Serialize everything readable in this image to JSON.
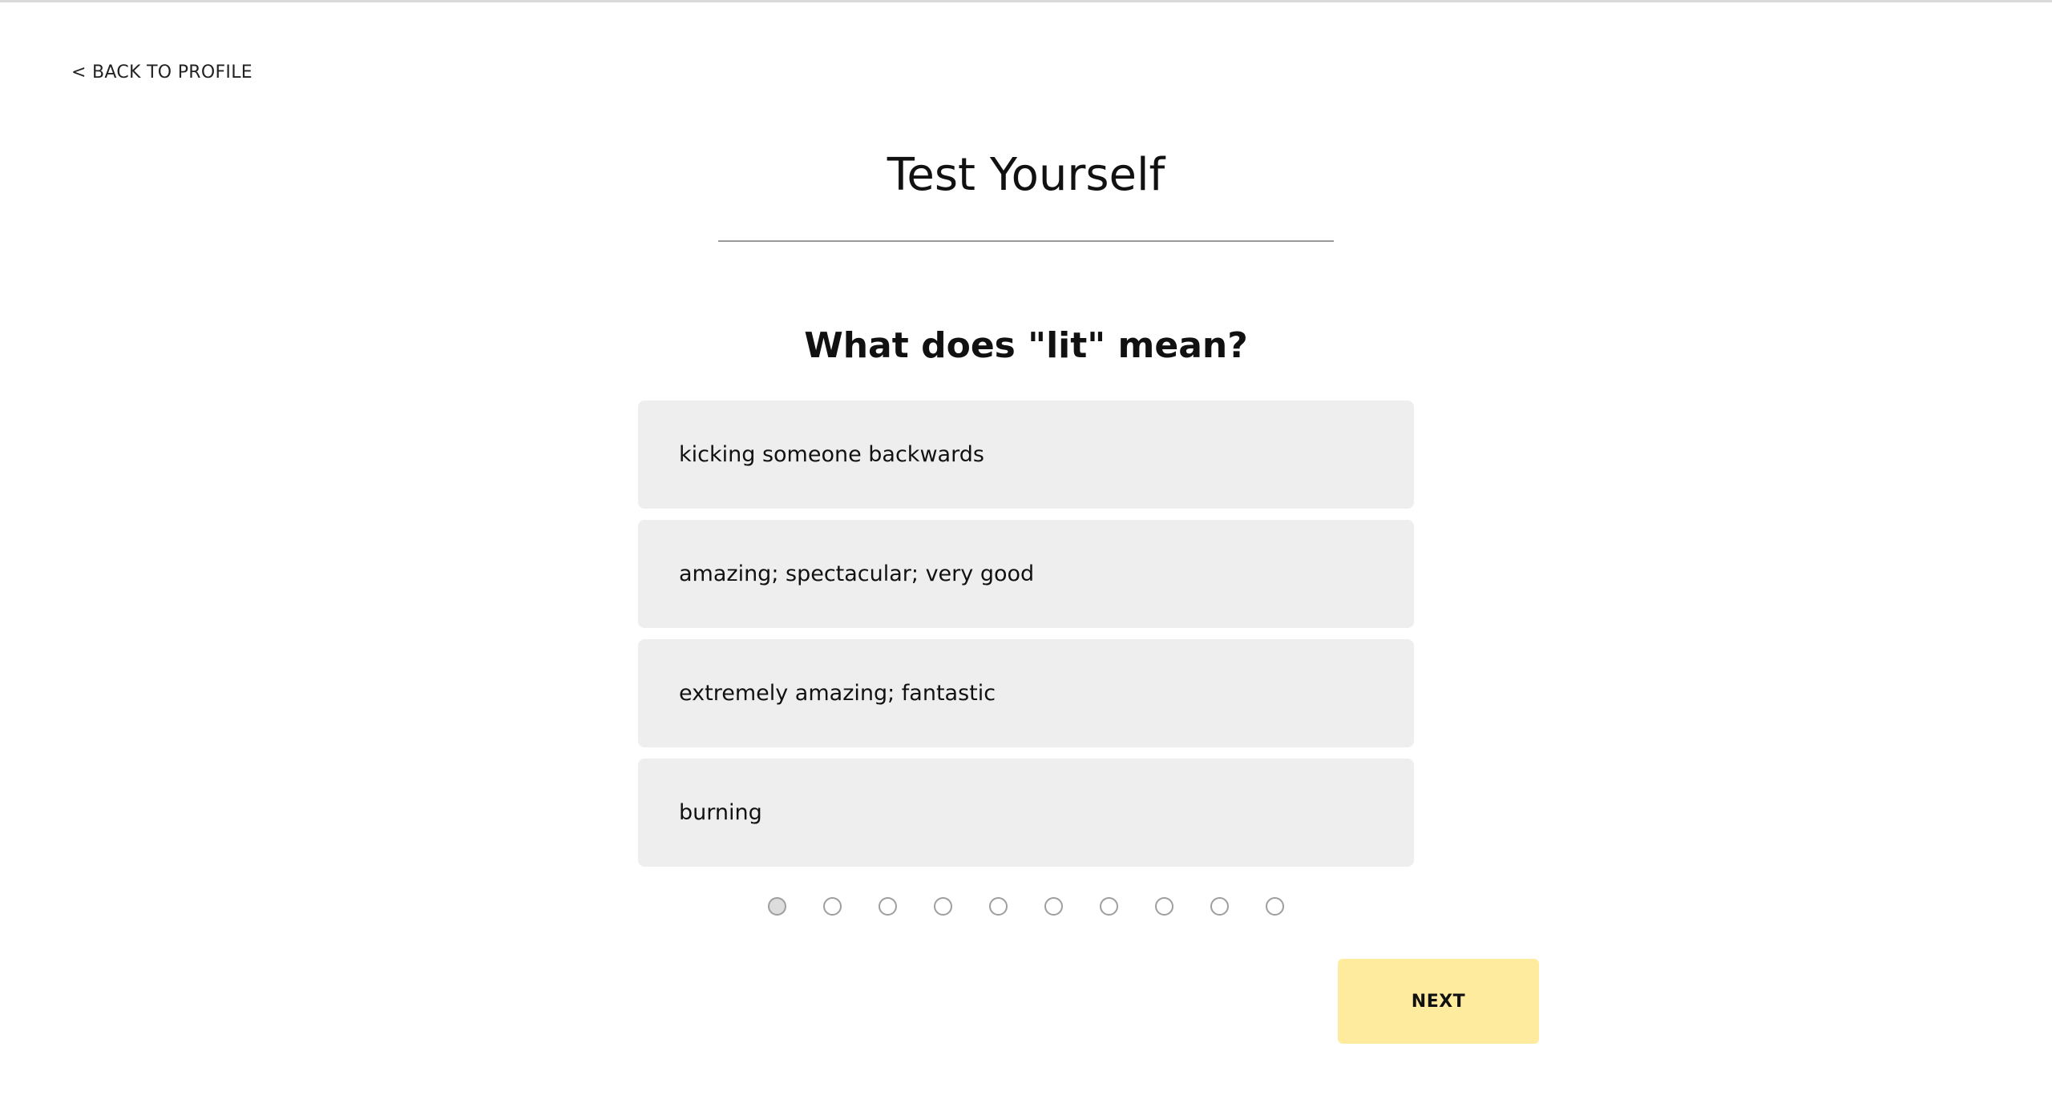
{
  "nav": {
    "back_label": "< BACK TO PROFILE"
  },
  "page": {
    "title": "Test Yourself"
  },
  "quiz": {
    "question": "What does \"lit\" mean?",
    "options": [
      {
        "label": "kicking someone backwards"
      },
      {
        "label": "amazing; spectacular; very good"
      },
      {
        "label": "extremely amazing; fantastic"
      },
      {
        "label": "burning"
      }
    ],
    "progress": {
      "current": 1,
      "total": 10
    },
    "next_label": "NEXT"
  },
  "colors": {
    "option_background": "#eeeeee",
    "next_button": "#ffeb9e",
    "divider": "#9a9a9a"
  }
}
